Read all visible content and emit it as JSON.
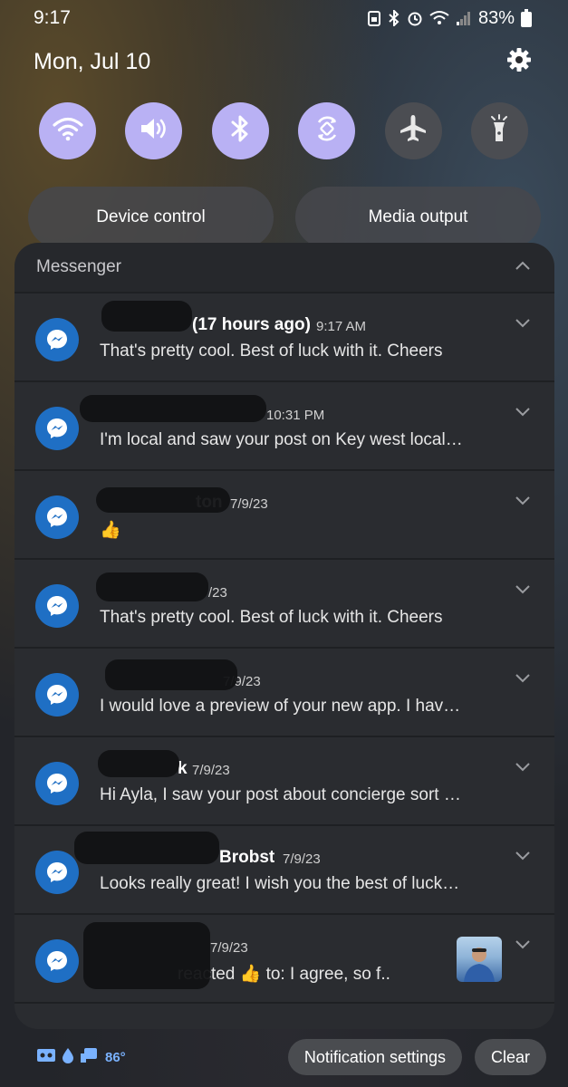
{
  "status_bar": {
    "time": "9:17",
    "battery": "83%"
  },
  "header": {
    "date": "Mon, Jul 10"
  },
  "quick_settings": [
    {
      "name": "wifi",
      "on": true
    },
    {
      "name": "sound",
      "on": true
    },
    {
      "name": "bluetooth",
      "on": true
    },
    {
      "name": "auto-rotate",
      "on": true
    },
    {
      "name": "airplane-mode",
      "on": false
    },
    {
      "name": "flashlight",
      "on": false
    }
  ],
  "controls": {
    "device_control": "Device control",
    "media_output": "Media output"
  },
  "panel": {
    "app_name": "Messenger"
  },
  "notifications": [
    {
      "title": "(17 hours ago)",
      "time": "9:17 AM",
      "body": "That's pretty cool. Best of luck with it. Cheers"
    },
    {
      "title": "",
      "time": "10:31 PM",
      "body": "I'm local and saw your post on Key west local…"
    },
    {
      "title": "ton",
      "time": "7/9/23",
      "body": "👍"
    },
    {
      "title": "",
      "time": "/23",
      "body": "That's pretty cool. Best of luck with it. Cheers"
    },
    {
      "title": "",
      "time": "7/9/23",
      "body": "I would love a preview of your new app. I hav…"
    },
    {
      "title": "k",
      "time": "7/9/23",
      "body": "Hi Ayla, I saw your post about concierge sort …"
    },
    {
      "title": "Brobst",
      "time": "7/9/23",
      "body": "Looks really great! I wish you the best of luck…"
    },
    {
      "title": "",
      "time": "7/9/23",
      "body": "reacted 👍 to: I agree, so f.."
    }
  ],
  "bottom_bar": {
    "temperature": "86°",
    "notification_settings": "Notification settings",
    "clear": "Clear"
  },
  "colors": {
    "qs_on": "#b9b1f4",
    "qs_off": "#4b4d52",
    "messenger_blue": "#1f6fc4"
  }
}
